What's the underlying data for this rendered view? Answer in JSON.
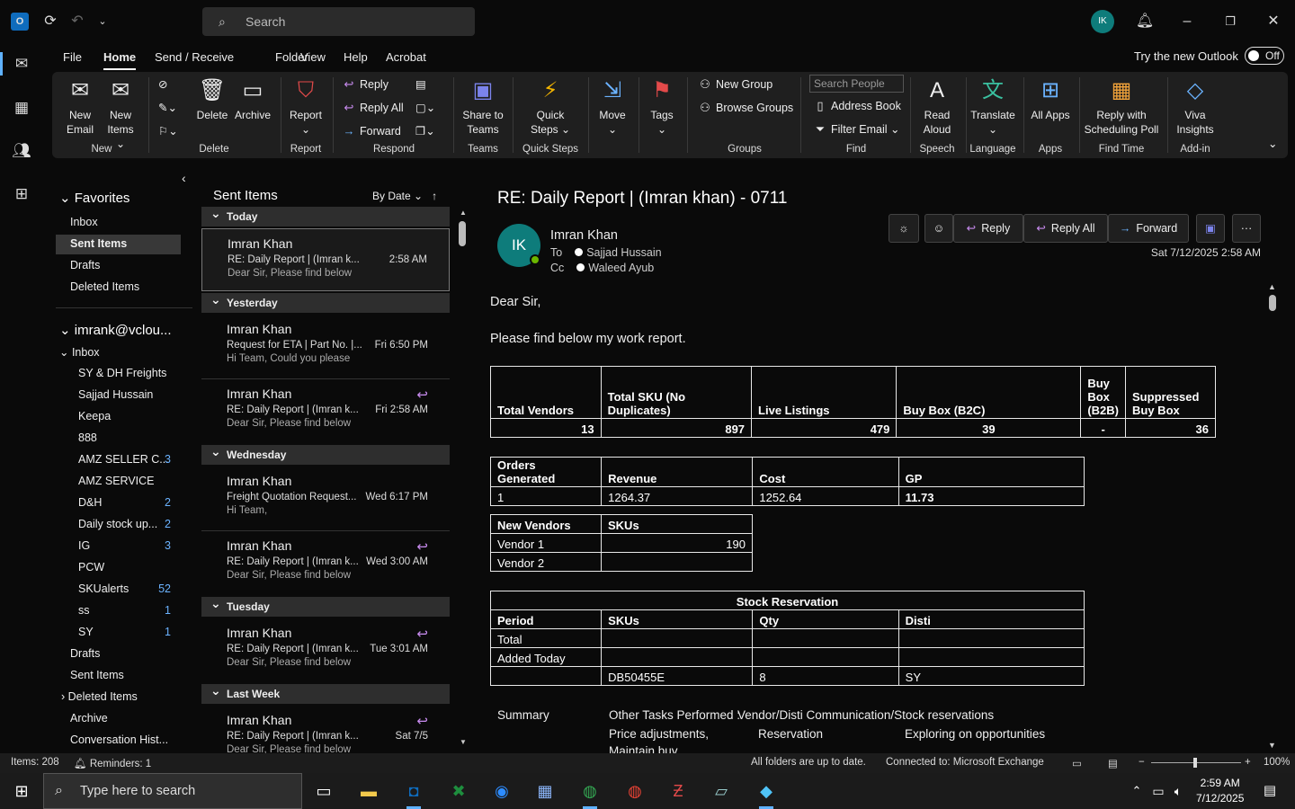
{
  "window": {
    "search_placeholder": "Search",
    "user_initials": "IK"
  },
  "menu": {
    "items": [
      "File",
      "Home",
      "Send / Receive",
      "Folder",
      "View",
      "Help",
      "Acrobat"
    ],
    "try_new": "Try the new Outlook",
    "toggle": "Off"
  },
  "ribbon": {
    "new_email": "New Email",
    "new_items": "New Items ⌄",
    "delete": "Delete",
    "archive": "Archive",
    "report": "Report",
    "reply": "Reply",
    "reply_all": "Reply All",
    "forward": "Forward",
    "share_teams": "Share to Teams",
    "quick_steps": "Quick Steps ⌄",
    "move": "Move",
    "tags": "Tags",
    "new_group": "New Group",
    "browse_groups": "Browse Groups",
    "search_people": "Search People",
    "address_book": "Address Book",
    "filter_email": "Filter Email ⌄",
    "read_aloud": "Read Aloud",
    "translate": "Translate",
    "all_apps": "All Apps",
    "reply_poll": "Reply with Scheduling Poll",
    "viva": "Viva Insights",
    "groups": [
      "New",
      "Delete",
      "Report",
      "Respond",
      "Teams",
      "Quick Steps",
      "Groups",
      "Find",
      "Speech",
      "Language",
      "Apps",
      "Find Time",
      "Add-in"
    ]
  },
  "folders": {
    "favorites_title": "Favorites",
    "favorites": [
      "Inbox",
      "Sent Items",
      "Drafts",
      "Deleted Items"
    ],
    "account": "imrank@vclou...",
    "inbox": "Inbox",
    "subfolders": [
      {
        "name": "SY & DH Freights",
        "count": ""
      },
      {
        "name": "Sajjad Hussain",
        "count": ""
      },
      {
        "name": "Keepa",
        "count": ""
      },
      {
        "name": "888",
        "count": ""
      },
      {
        "name": "AMZ SELLER C...",
        "count": "3"
      },
      {
        "name": "AMZ SERVICE",
        "count": ""
      },
      {
        "name": "D&H",
        "count": "2"
      },
      {
        "name": "Daily stock up...",
        "count": "2"
      },
      {
        "name": "IG",
        "count": "3"
      },
      {
        "name": "PCW",
        "count": ""
      },
      {
        "name": "SKUalerts",
        "count": "52"
      },
      {
        "name": "ss",
        "count": "1"
      },
      {
        "name": "SY",
        "count": "1"
      }
    ],
    "rest": [
      "Drafts",
      "Sent Items",
      "Deleted Items",
      "Archive",
      "Conversation Hist..."
    ]
  },
  "list": {
    "title": "Sent Items",
    "sort": "By Date",
    "groups": [
      "Today",
      "Yesterday",
      "Wednesday",
      "Tuesday",
      "Last Week"
    ],
    "items": [
      {
        "from": "Imran Khan",
        "subject": "RE:  Daily Report | (Imran k...",
        "preview": "Dear Sir,  Please find below",
        "date": "2:58 AM"
      },
      {
        "from": "Imran Khan",
        "subject": "Request for ETA | Part No. |...",
        "preview": "Hi Team,  Could you please",
        "date": "Fri 6:50 PM"
      },
      {
        "from": "Imran Khan",
        "subject": "RE:  Daily Report | (Imran k...",
        "preview": "Dear Sir,  Please find below",
        "date": "Fri 2:58 AM"
      },
      {
        "from": "Imran Khan",
        "subject": "Freight Quotation Request...",
        "preview": "Hi Team,",
        "date": "Wed 6:17 PM"
      },
      {
        "from": "Imran Khan",
        "subject": "RE:  Daily Report | (Imran k...",
        "preview": "Dear Sir,  Please find below",
        "date": "Wed 3:00 AM"
      },
      {
        "from": "Imran Khan",
        "subject": "RE:  Daily Report | (Imran k...",
        "preview": "Dear Sir,  Please find below",
        "date": "Tue 3:01 AM"
      },
      {
        "from": "Imran Khan",
        "subject": "RE:  Daily Report | (Imran k...",
        "preview": "Dear Sir,  Please find below",
        "date": "Sat 7/5"
      }
    ]
  },
  "reading": {
    "subject": "RE:  Daily Report | (Imran khan) - 0711",
    "initials": "IK",
    "from": "Imran Khan",
    "to_label": "To",
    "to": "Sajjad Hussain",
    "cc_label": "Cc",
    "cc": "Waleed Ayub",
    "date": "Sat 7/12/2025 2:58 AM",
    "actions": {
      "reply": "Reply",
      "reply_all": "Reply All",
      "forward": "Forward"
    },
    "greeting": "Dear Sir,",
    "intro": "Please find below my work report.",
    "t1": {
      "h": [
        "Total Vendors",
        "Total SKU (No Duplicates)",
        "Live Listings",
        "Buy Box (B2C)",
        "Buy Box (B2B)",
        "Suppressed Buy Box"
      ],
      "v": [
        "13",
        "897",
        "479",
        "39",
        "-",
        "36"
      ]
    },
    "t2": {
      "h": [
        "Orders Generated",
        "Revenue",
        "Cost",
        "GP"
      ],
      "v": [
        "1",
        "1264.37",
        "1252.64",
        "11.73"
      ]
    },
    "t3": {
      "h": [
        "New Vendors",
        "SKUs"
      ],
      "r1": [
        "Vendor 1",
        "190"
      ],
      "r2": [
        "Vendor 2",
        ""
      ]
    },
    "t4": {
      "title": "Stock Reservation",
      "h": [
        "Period",
        "SKUs",
        "Qty",
        "Disti"
      ],
      "r1": [
        "Total"
      ],
      "r2": [
        "Added Today"
      ],
      "r3": [
        "",
        "DB50455E",
        "8",
        "SY"
      ]
    },
    "summary": {
      "label": "Summary",
      "other": "Other Tasks Performed :",
      "other_val": "Vendor/Disti Communication/Stock reservations",
      "c1": "Price adjustments,",
      "c2": "Reservation",
      "c3": "Exploring on opportunities",
      "c4": "Maintain buy"
    }
  },
  "status": {
    "items": "Items: 208",
    "reminders": "Reminders: 1",
    "folders": "All folders are up to date.",
    "connected": "Connected to: Microsoft Exchange",
    "zoom": "100%"
  },
  "taskbar": {
    "search": "Type here to search",
    "time": "2:59 AM",
    "date": "7/12/2025"
  }
}
